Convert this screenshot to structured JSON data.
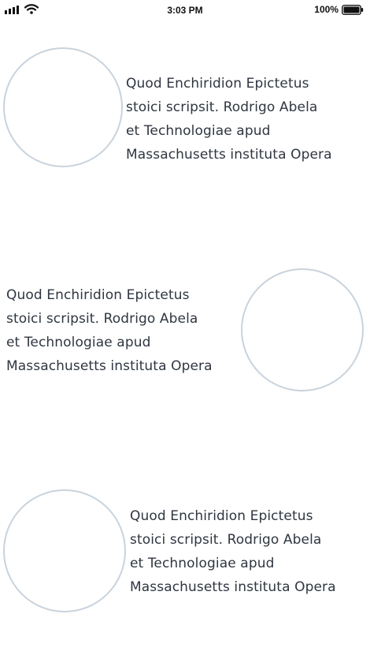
{
  "status_bar": {
    "time": "3:03 PM",
    "battery_percent": "100%",
    "battery_level": 1.0,
    "signal_icon": "signal-bars-icon",
    "wifi_icon": "wifi-icon",
    "battery_icon": "battery-icon"
  },
  "rows": [
    {
      "text": "Quod Enchiridion Epictetus\nstoici scripsit. Rodrigo Abela\net Technologiae apud\nMassachusetts instituta Opera",
      "image_position": "left"
    },
    {
      "text": "Quod Enchiridion Epictetus\nstoici scripsit. Rodrigo Abela\net Technologiae apud\nMassachusetts instituta Opera",
      "image_position": "right"
    },
    {
      "text": "Quod Enchiridion Epictetus\nstoici scripsit. Rodrigo Abela\net Technologiae apud\nMassachusetts instituta Opera",
      "image_position": "left"
    }
  ],
  "colors": {
    "circle_border": "#c9d3dc",
    "text": "#2f3640",
    "background": "#ffffff"
  }
}
